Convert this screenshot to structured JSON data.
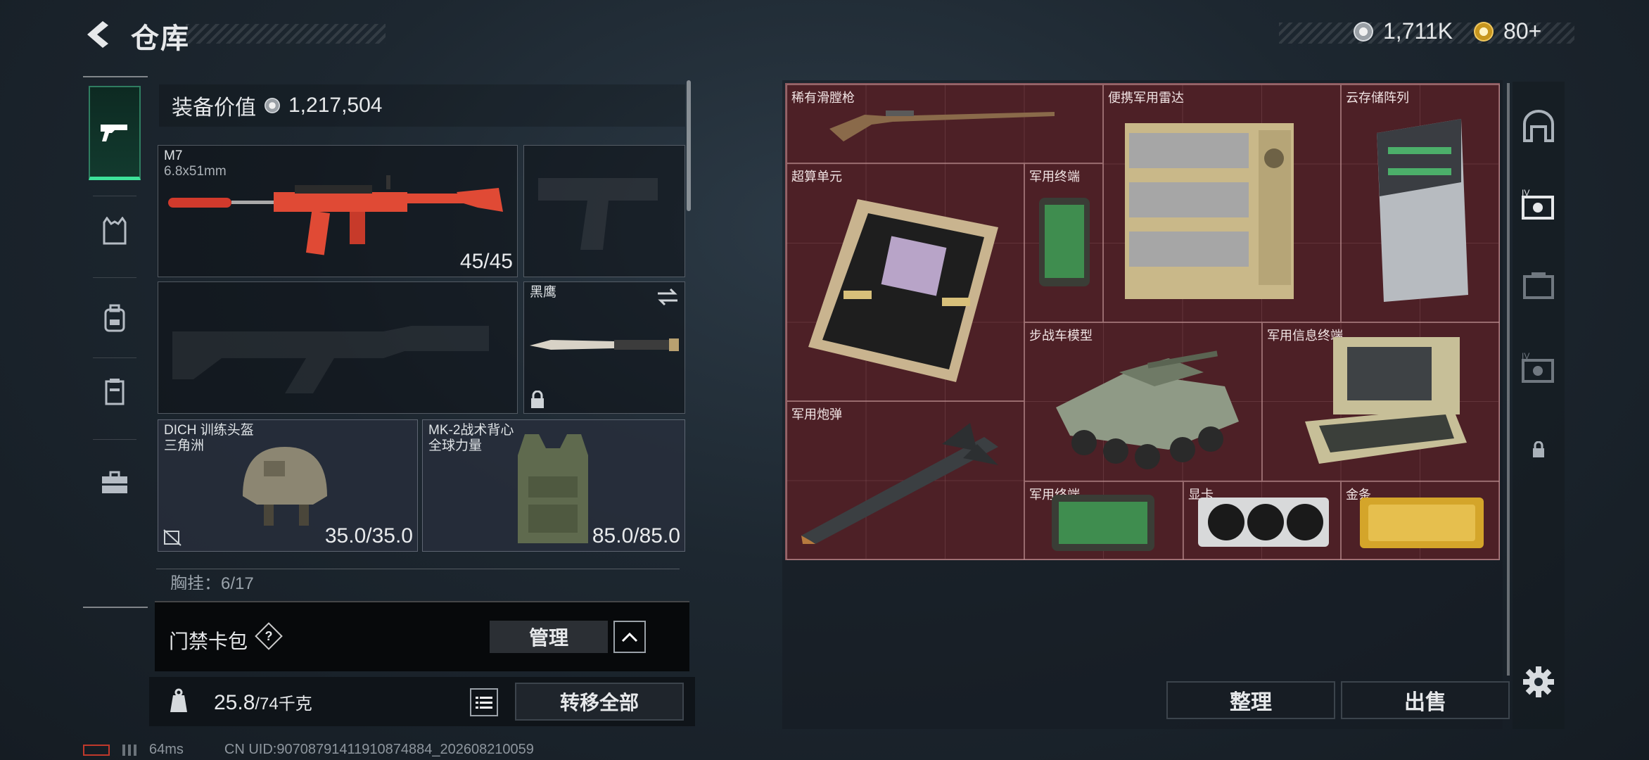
{
  "header": {
    "title": "仓库"
  },
  "currencies": [
    {
      "icon": "silver-coin-icon",
      "value": "1,711K"
    },
    {
      "icon": "gold-coin-icon",
      "value": "80+"
    }
  ],
  "left_rail": {
    "tabs": [
      {
        "name": "weapons",
        "icon": "pistol-icon",
        "active": true
      },
      {
        "name": "armor",
        "icon": "vest-icon"
      },
      {
        "name": "backpack",
        "icon": "backpack-icon"
      },
      {
        "name": "chest-rig",
        "icon": "rig-icon"
      },
      {
        "name": "toolbox",
        "icon": "toolbox-icon"
      }
    ]
  },
  "equipment": {
    "value_label": "装备价值",
    "value": "1,217,504",
    "primary": {
      "name": "M7",
      "ammo_type": "6.8x51mm",
      "ammo": "45/45"
    },
    "melee": {
      "name": "黑鹰"
    },
    "helmet": {
      "name": "DICH 训练头盔",
      "origin": "三角洲",
      "durability": "35.0/35.0"
    },
    "armor": {
      "name": "MK-2战术背心",
      "origin": "全球力量",
      "durability": "85.0/85.0"
    },
    "chest_rig_partial": "胸挂：6/17"
  },
  "keycard": {
    "label": "门禁卡包",
    "help": "?",
    "manage": "管理"
  },
  "weight": {
    "current": "25.8",
    "max_unit": "/74千克",
    "transfer_all": "转移全部"
  },
  "storage": {
    "items": [
      {
        "id": "musket",
        "label": "稀有滑膛枪"
      },
      {
        "id": "radar",
        "label": "便携军用雷达"
      },
      {
        "id": "storage-array",
        "label": "云存储阵列"
      },
      {
        "id": "supercomputer",
        "label": "超算单元"
      },
      {
        "id": "terminal-1",
        "label": "军用终端"
      },
      {
        "id": "ifv-model",
        "label": "步战车模型"
      },
      {
        "id": "info-terminal",
        "label": "军用信息终端"
      },
      {
        "id": "shell",
        "label": "军用炮弹"
      },
      {
        "id": "terminal-2",
        "label": "军用终端"
      },
      {
        "id": "gpu",
        "label": "显卡"
      },
      {
        "id": "gold-bar",
        "label": "金条"
      }
    ],
    "sort": "整理",
    "sell": "出售"
  },
  "footer": {
    "ping": "64ms",
    "uid": "CN UID:90708791411910874884_202608210059"
  }
}
